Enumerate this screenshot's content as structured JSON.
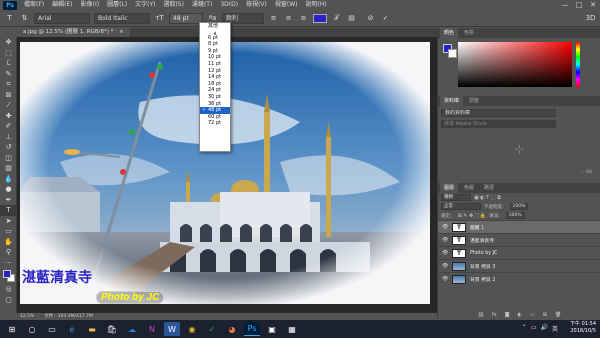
{
  "app": {
    "logo": "Ps"
  },
  "menu": [
    "檔案(F)",
    "編輯(E)",
    "影像(I)",
    "圖層(L)",
    "文字(Y)",
    "選取(S)",
    "濾鏡(T)",
    "3D(D)",
    "檢視(V)",
    "視窗(W)",
    "說明(H)"
  ],
  "window_controls": {
    "minimize": "—",
    "maximize": "□",
    "close": "✕"
  },
  "options_bar": {
    "tool_icon": "type-tool-icon",
    "orientation_icon": "text-orientation-icon",
    "font_family": "Arial",
    "font_style": "Bold Italic",
    "font_size": "48 pt",
    "antialias": "銳利",
    "text_color": "#2a23c4",
    "commit_icons": [
      "cancel-icon",
      "commit-icon",
      "3d-icon"
    ]
  },
  "document": {
    "tab_title": "a.jpg @ 12.5% (圖層 1, RGB/8*) *",
    "tab_close": "×"
  },
  "font_size_menu": {
    "header": "其他",
    "items": [
      "6 pt",
      "8 pt",
      "9 pt",
      "10 pt",
      "11 pt",
      "12 pt",
      "14 pt",
      "18 pt",
      "24 pt",
      "30 pt",
      "36 pt",
      "48 pt",
      "60 pt",
      "72 pt"
    ],
    "selected": "48 pt"
  },
  "canvas": {
    "caption_cn": "湛藍清真寺",
    "caption_en": "Photo by JC",
    "caption_cn_color": "#2a23c4",
    "caption_en_color": "#ffff00"
  },
  "status": {
    "zoom": "12.5%",
    "doc_size": "文件：103.4M/417.7M"
  },
  "panels": {
    "color_tabs": [
      "顏色",
      "色票"
    ],
    "library_tabs": [
      "資料庫",
      "調整"
    ],
    "library_select": "我的資料庫",
    "library_search": "搜尋 Adobe Stock",
    "library_size": "-- KB",
    "layers_tabs": [
      "圖層",
      "色版",
      "路徑"
    ],
    "kind_filter": "種類",
    "blend_mode": "正常",
    "opacity_label": "不透明度：",
    "opacity_value": "100%",
    "lock_label": "鎖定：",
    "fill_label": "填滿：",
    "fill_value": "100%",
    "layers": [
      {
        "name": "圖層 1",
        "kind": "text",
        "selected": true
      },
      {
        "name": "湛藍清真寺",
        "kind": "text",
        "selected": false
      },
      {
        "name": "Photo by JC",
        "kind": "text",
        "selected": false
      },
      {
        "name": "背景 拷貝 3",
        "kind": "image",
        "selected": false
      },
      {
        "name": "背景 拷貝 2",
        "kind": "image",
        "selected": false
      }
    ]
  },
  "taskbar": {
    "time": "下午 01:54",
    "date": "2018/10/5",
    "ime": "英"
  }
}
